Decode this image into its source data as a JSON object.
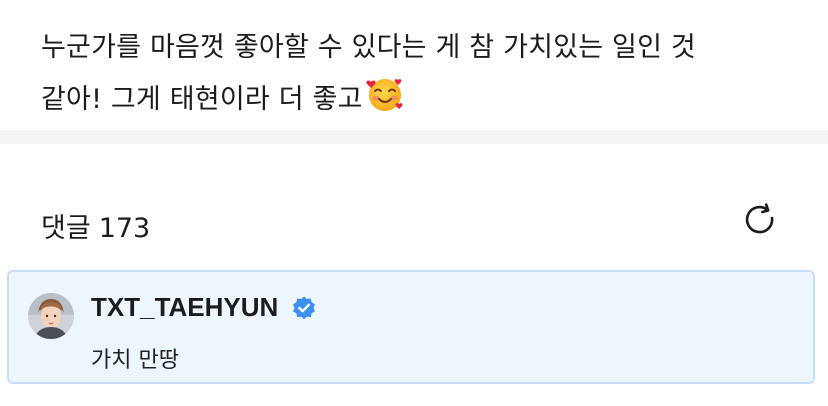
{
  "post": {
    "line1": "누군가를 마음껏 좋아할 수 있다는 게 참 가치있는 일인 것",
    "line2": "같아! 그게 태현이라 더 좋고",
    "emoji_icon": "smiling-face-with-hearts-icon"
  },
  "comments": {
    "title": "댓글",
    "count": "173",
    "refresh_icon": "refresh-icon"
  },
  "highlighted_comment": {
    "author": "TXT_TAEHYUN",
    "verified_icon": "verified-badge-icon",
    "text": "가치 만땅",
    "accent_color": "#3f8ff0",
    "card_background": "#eef6fd",
    "card_border": "#c6dff7"
  }
}
